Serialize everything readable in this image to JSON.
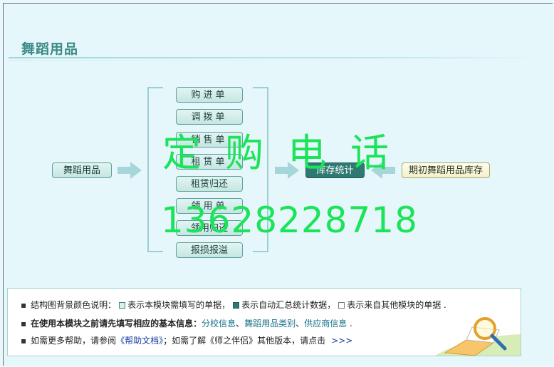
{
  "module": {
    "title": "舞蹈用品"
  },
  "flow": {
    "source_label": "舞蹈用品",
    "documents": [
      "购进单",
      "调拨单",
      "销售单",
      "租赁单",
      "租赁归还",
      "领用单",
      "领用归还",
      "报损报溢"
    ],
    "stock_label": "库存统计",
    "initial_label": "期初舞蹈用品库存"
  },
  "watermark": {
    "title": "定购电话",
    "phone": "13628228718"
  },
  "info": {
    "legend_prefix": "结构图背景颜色说明：",
    "legend_1": "表示本模块需填写的单据，",
    "legend_2": "表示自动汇总统计数据，",
    "legend_3": "表示来自其他模块的单据 .",
    "prereq_prefix": "在使用本模块之前请先填写相应的基本信息：",
    "prereq_link_1": "分校信息",
    "sep_1": "、",
    "prereq_link_2": "舞蹈用品类别",
    "sep_2": "、",
    "prereq_link_3": "供应商信息",
    "prereq_suffix": " .",
    "help_prefix": "如需更多帮助，请参阅",
    "help_link": "《帮助文档》",
    "help_middle": "；如需了解《师之伴侣》其他版本，请点击",
    "help_more": ">>>"
  },
  "colors": {
    "fill_required": "#d8f0ee",
    "fill_auto": "#2e7a72",
    "fill_external": "#ffffff",
    "watermark": "#1be35a",
    "title": "#3c8a88"
  }
}
